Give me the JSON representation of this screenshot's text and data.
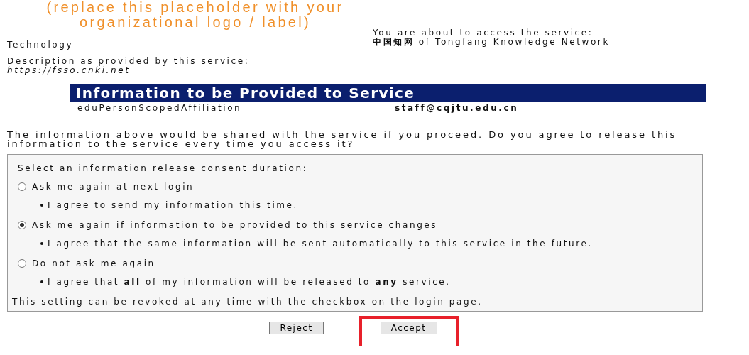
{
  "logo_placeholder": [
    "(replace this placeholder with your",
    "organizational logo / label)"
  ],
  "category": "Technology",
  "service_notice": {
    "intro": "You are about to access the service:",
    "service": "**中国知网** of Tongfang Knowledge Network"
  },
  "description": {
    "label": "Description as provided by this service:",
    "url": "https://fsso.cnki.net"
  },
  "attributes": {
    "title": "Information to be Provided to Service",
    "rows": [
      {
        "name": "eduPersonScopedAffiliation",
        "value": "staff@cqjtu.edu.cn"
      }
    ]
  },
  "prompt": "The information above would be shared with the service if you proceed. Do you agree to release this information to the service every time you access it?",
  "consent": {
    "heading": "Select an information release consent duration:",
    "options": [
      {
        "label": "Ask me again at next login",
        "selected": false,
        "note": "I agree to send my information this time."
      },
      {
        "label": "Ask me again if information to be provided to this service changes",
        "selected": true,
        "note": "I agree that the same information will be sent automatically to this service in the future."
      },
      {
        "label": "Do not ask me again",
        "selected": false,
        "note": "I agree that **all** of my information will be released to **any** service."
      }
    ],
    "footer": "This setting can be revoked at any time with the checkbox on the login page."
  },
  "buttons": [
    {
      "label": "Reject",
      "highlighted": false
    },
    {
      "label": "Accept",
      "highlighted": true
    }
  ]
}
